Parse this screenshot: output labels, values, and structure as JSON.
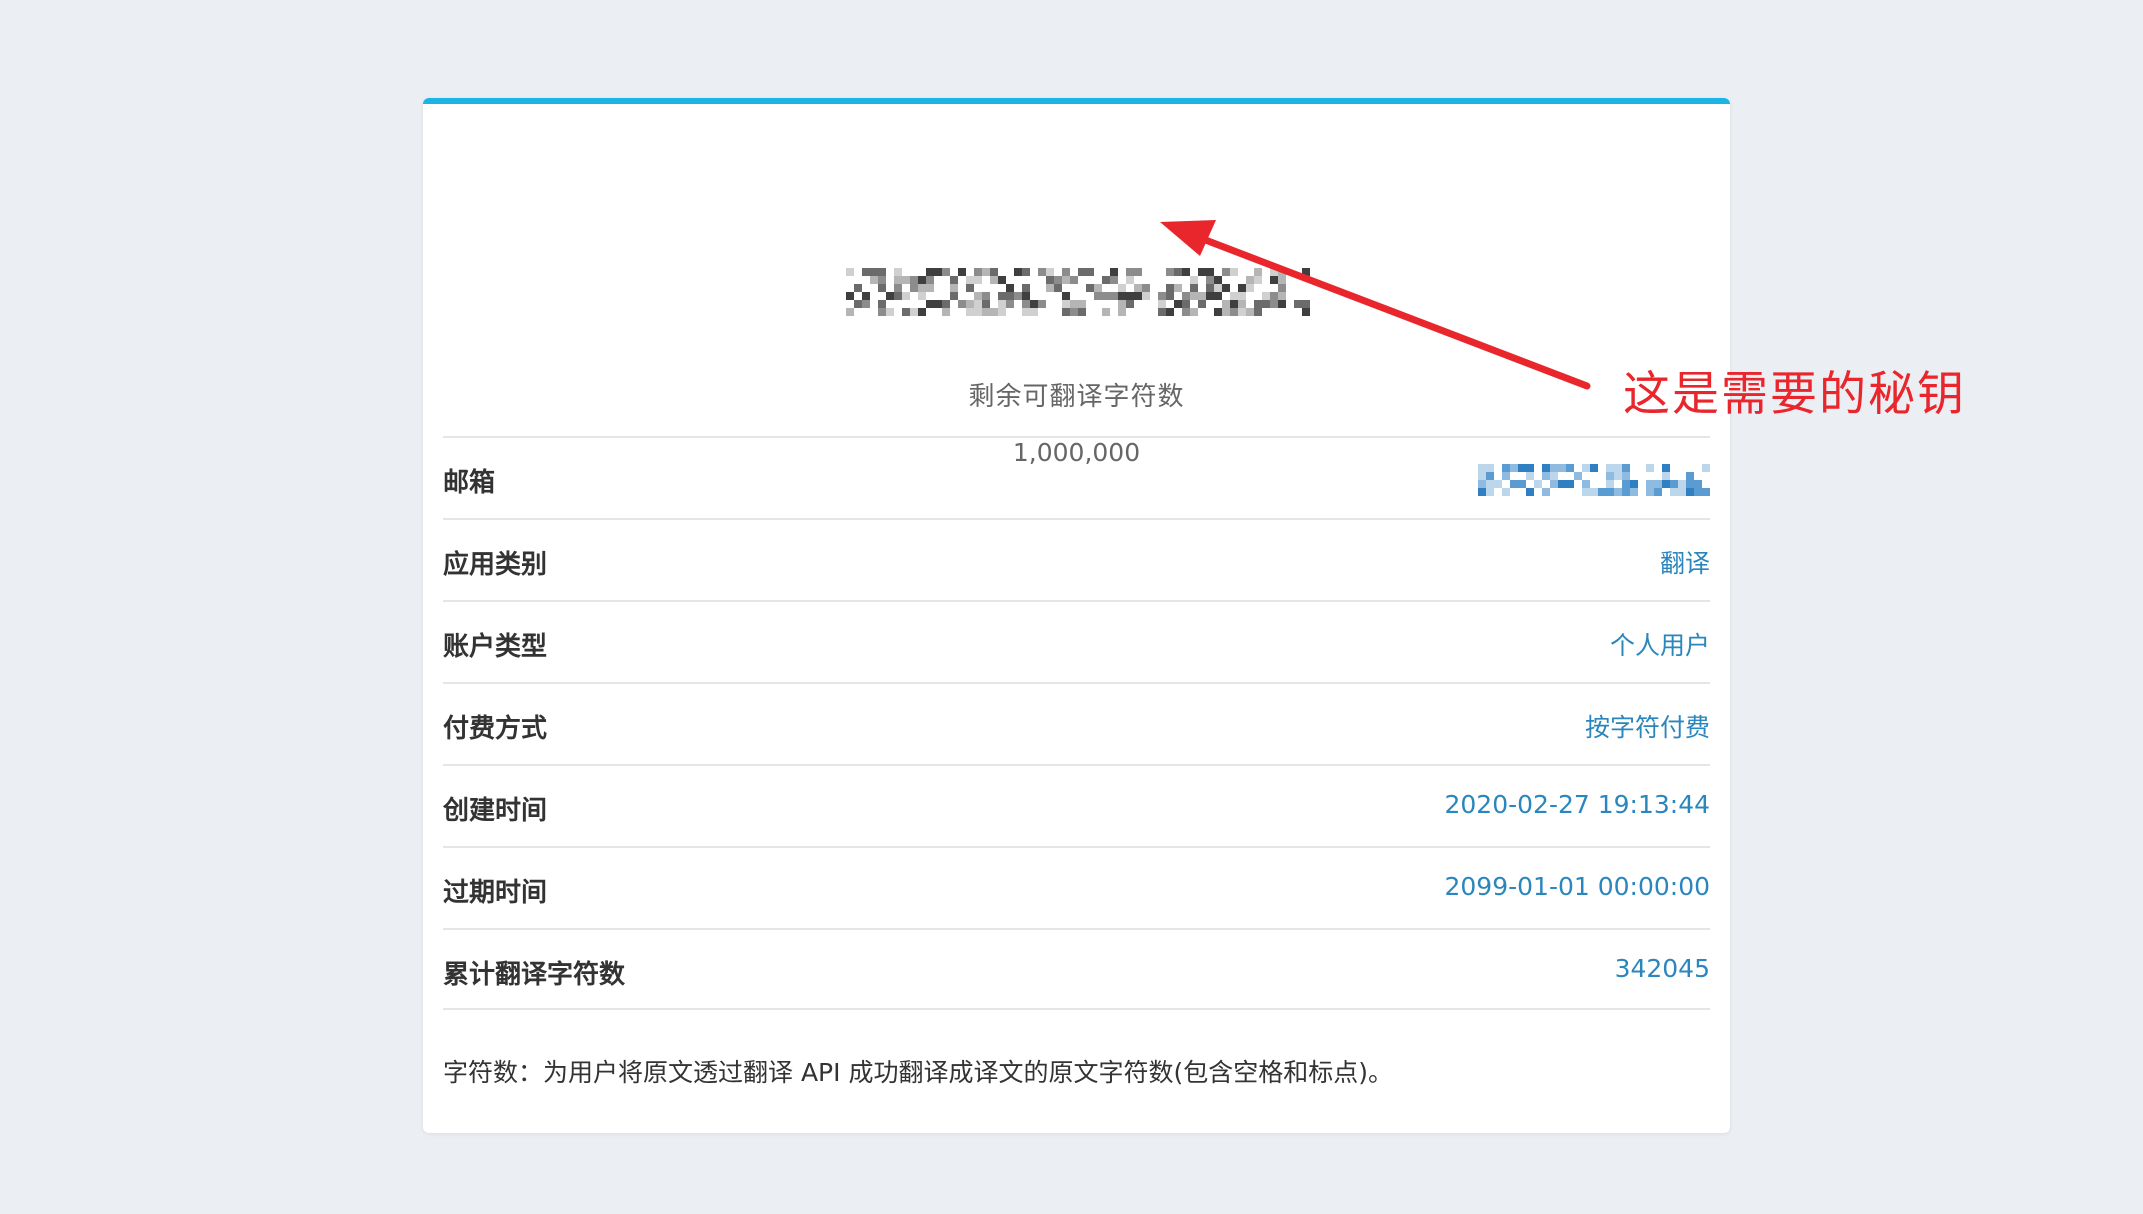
{
  "card": {
    "secret_key": "vcwgtdnlwnrg/7rvxk",
    "remaining_label": "剩余可翻译字符数",
    "remaining_value": "1,000,000",
    "rows": [
      {
        "label": "邮箱",
        "value": ""
      },
      {
        "label": "应用类别",
        "value": "翻译"
      },
      {
        "label": "账户类型",
        "value": "个人用户"
      },
      {
        "label": "付费方式",
        "value": "按字符付费"
      },
      {
        "label": "创建时间",
        "value": "2020-02-27 19:13:44"
      },
      {
        "label": "过期时间",
        "value": "2099-01-01 00:00:00"
      },
      {
        "label": "累计翻译字符数",
        "value": "342045"
      }
    ],
    "footnote": "字符数：为用户将原文透过翻译 API 成功翻译成译文的原文字符数(包含空格和标点)。"
  },
  "annotation": {
    "text": "这是需要的秘钥"
  },
  "colors": {
    "background": "#ebeef3",
    "accent_bar": "#1bb4e6",
    "value_text": "#2a86bd",
    "annotation": "#e8262c"
  }
}
